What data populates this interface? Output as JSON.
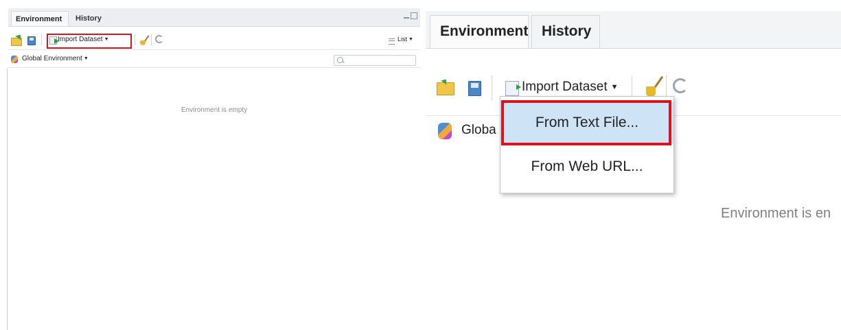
{
  "left_panel": {
    "tabs": [
      {
        "label": "Environment",
        "active": true
      },
      {
        "label": "History",
        "active": false
      }
    ],
    "toolbar": {
      "open_icon": "open-folder-icon",
      "save_icon": "save-icon",
      "import_label": "Import Dataset",
      "import_highlighted": true,
      "clear_icon": "broom-icon",
      "refresh_icon": "refresh-icon",
      "view_mode": "List"
    },
    "environment_selector": "Global Environment",
    "search": {
      "placeholder": ""
    },
    "empty_message": "Environment is empty"
  },
  "right_panel": {
    "tabs": [
      {
        "label": "Environment",
        "active": true
      },
      {
        "label": "History",
        "active": false
      }
    ],
    "toolbar": {
      "import_label": "Import Dataset"
    },
    "environment_selector_visible": "Globa",
    "dropdown": {
      "items": [
        {
          "label": "From Text File...",
          "highlighted": true
        },
        {
          "label": "From Web URL...",
          "highlighted": false
        }
      ]
    },
    "empty_message_visible": "Environment is en"
  },
  "colors": {
    "highlight_red": "#d8141e",
    "menu_hover": "#cfe3f6",
    "tab_bar": "#eceef1"
  }
}
